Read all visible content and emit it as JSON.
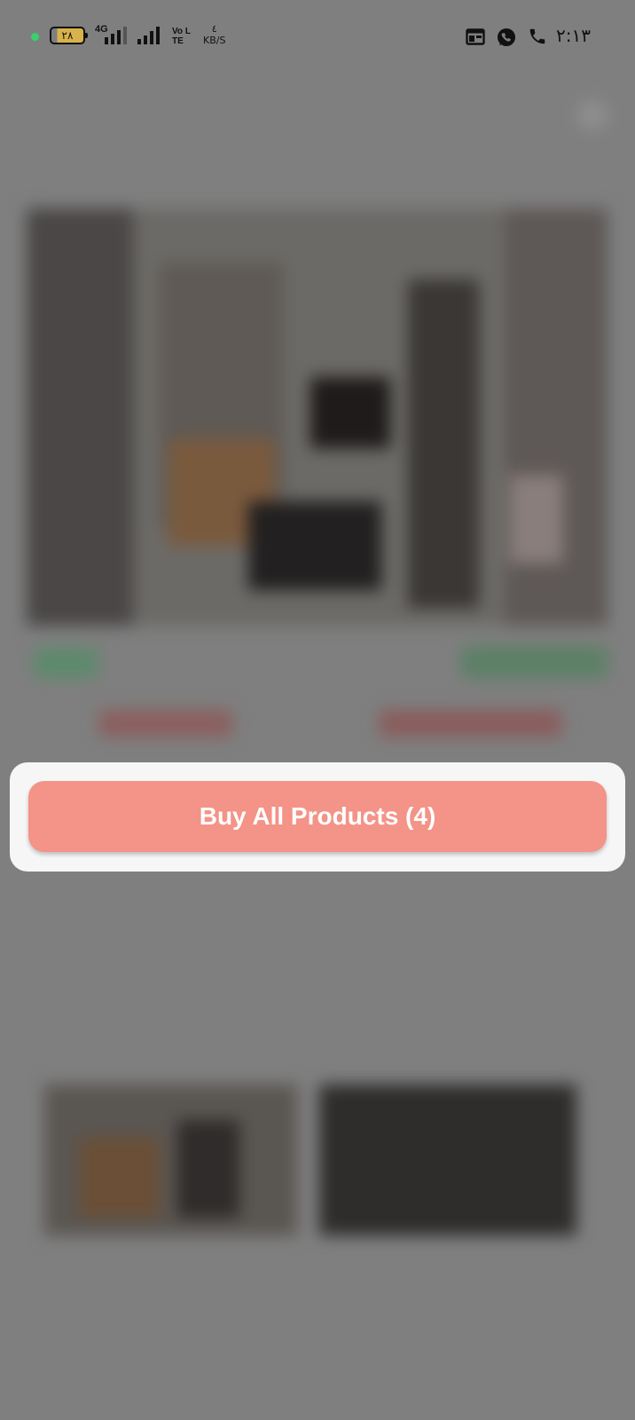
{
  "status_bar": {
    "battery_level": "٢٨",
    "network_type": "4G",
    "volte_label": "Vo LTE",
    "speed_value": "٤",
    "speed_unit": "KB/S",
    "time": "٢:١٣",
    "icons": [
      "notification-dot-icon",
      "battery-icon",
      "signal-sim1-icon",
      "signal-sim2-icon",
      "volte-icon",
      "calendar-icon",
      "whatsapp-icon",
      "phone-call-icon"
    ],
    "colors": {
      "dot": "#3ad06a",
      "battery_fill": "#d8b24a"
    }
  },
  "sheet": {
    "buy_all_label": "Buy All Products (4)",
    "button_color": "#f49387"
  },
  "background": {
    "overlay_color": "#7f7f7f"
  }
}
